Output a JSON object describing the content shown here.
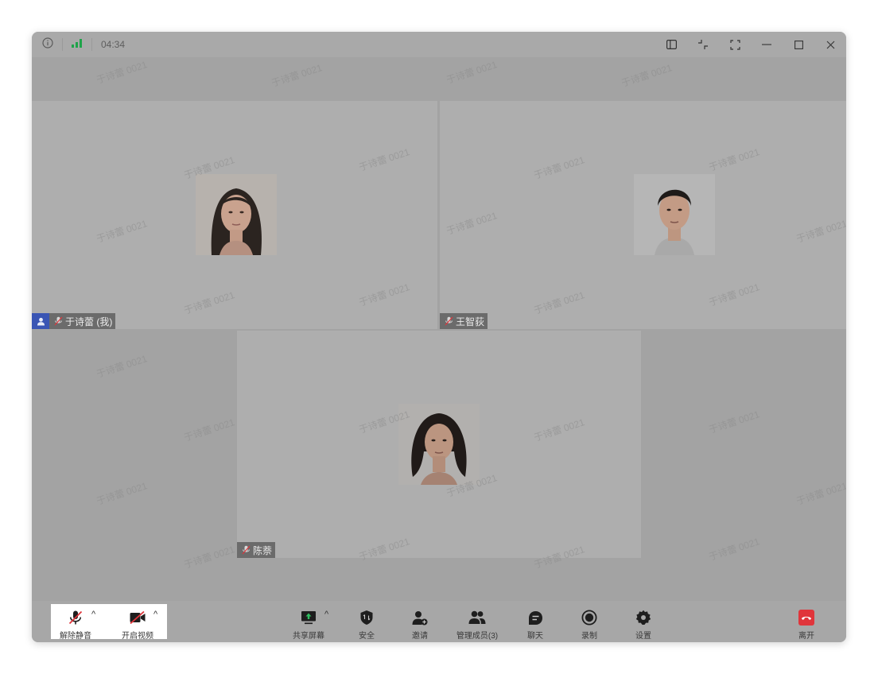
{
  "titlebar": {
    "time": "04:34",
    "info_icon": "info-circle-icon",
    "signal_icon": "signal-bars-icon",
    "buttons": [
      "sidebar-layout-icon",
      "exit-fullscreen-icon",
      "fullscreen-icon",
      "minimize-icon",
      "maximize-icon",
      "close-icon"
    ]
  },
  "watermark_text": "于诗蕾 0021",
  "participants": [
    {
      "name": "于诗蕾 (我)",
      "is_self": true,
      "mic": "muted"
    },
    {
      "name": "王智荻",
      "is_self": false,
      "mic": "muted"
    },
    {
      "name": "陈萘",
      "is_self": false,
      "mic": "muted"
    }
  ],
  "toolbar": {
    "unmute": "解除静音",
    "start_video": "开启视频",
    "share_screen": "共享屏幕",
    "security": "安全",
    "invite": "邀请",
    "manage_members": "管理成员(3)",
    "chat": "聊天",
    "record": "录制",
    "settings": "设置",
    "leave": "离开",
    "caret": "^"
  },
  "colors": {
    "signal_green": "#1fa34a",
    "self_badge_blue": "#3a55b4",
    "leave_red": "#e0353b",
    "muted_red": "#e0353b"
  }
}
